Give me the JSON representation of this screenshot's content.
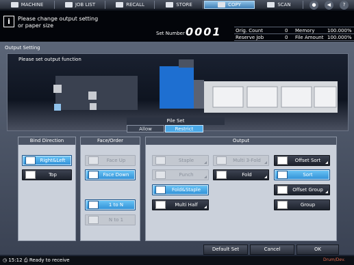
{
  "tabs": [
    {
      "label": "MACHINE",
      "icon": "machine-icon"
    },
    {
      "label": "JOB LIST",
      "icon": "job-list-icon"
    },
    {
      "label": "RECALL",
      "icon": "recall-icon"
    },
    {
      "label": "STORE",
      "icon": "store-icon"
    },
    {
      "label": "COPY",
      "icon": "copy-icon"
    },
    {
      "label": "SCAN",
      "icon": "scan-icon"
    }
  ],
  "message": "Please change output setting\nor paper size",
  "set_number": {
    "label": "Set Number",
    "value": "0001"
  },
  "counters": {
    "orig_count_label": "Orig. Count",
    "orig_count": "0",
    "memory_label": "Memory",
    "memory": "100.000%",
    "reserve_job_label": "Reserve Job",
    "reserve_job": "0",
    "file_amount_label": "File Amount",
    "file_amount": "100.000%"
  },
  "panel_title": "Output Setting",
  "canvas_label": "Please set output function",
  "pile_set": {
    "label": "Pile Set",
    "allow": "Allow",
    "restrict": "Restrict"
  },
  "bind_direction": {
    "header": "Bind Direction",
    "right_left": "Right&Left",
    "top": "Top"
  },
  "face_order": {
    "header": "Face/Order",
    "face_up": "Face Up",
    "face_down": "Face Down",
    "one_to_n": "1 to N",
    "n_to_one": "N to 1"
  },
  "output": {
    "header": "Output",
    "staple": "Staple",
    "punch": "Punch",
    "fold_staple": "Fold&Staple",
    "multi_half": "Multi Half",
    "multi_3fold": "Multi 3-Fold",
    "fold": "Fold",
    "offset_sort": "Offset Sort",
    "sort": "Sort",
    "offset_group": "Offset Group",
    "group": "Group"
  },
  "footer": {
    "default_set": "Default Set",
    "cancel": "Cancel",
    "ok": "OK"
  },
  "status": {
    "time": "15:12",
    "text": "Ready to receive",
    "drum": "Drum/Dev."
  },
  "colors": {
    "accent": "#4aa8e6",
    "dark_bg": "#03050a"
  }
}
